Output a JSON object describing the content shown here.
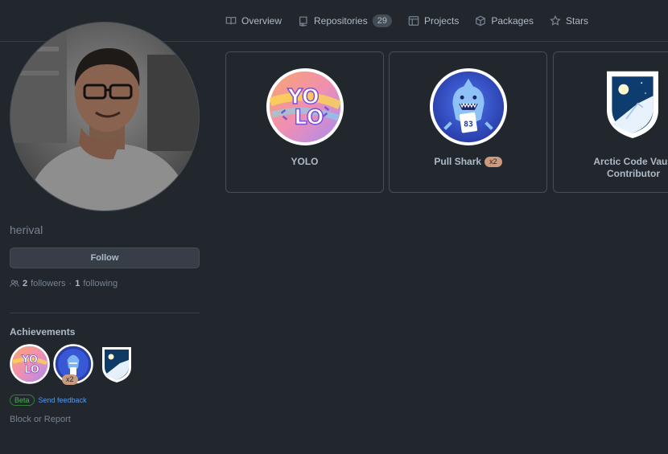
{
  "nav": {
    "items": [
      {
        "label": "Overview",
        "icon": "book-icon"
      },
      {
        "label": "Repositories",
        "icon": "repo-icon",
        "count": "29"
      },
      {
        "label": "Projects",
        "icon": "project-table-icon"
      },
      {
        "label": "Packages",
        "icon": "package-icon"
      },
      {
        "label": "Stars",
        "icon": "star-icon"
      }
    ]
  },
  "profile": {
    "username": "herival",
    "follow_label": "Follow",
    "followers_count": "2",
    "followers_label": "followers",
    "separator": "·",
    "following_count": "1",
    "following_label": "following"
  },
  "achievements": {
    "title": "Achievements",
    "mini_count": "x2",
    "beta_label": "Beta",
    "feedback_label": "Send feedback",
    "block_label": "Block or Report"
  },
  "cards": [
    {
      "title": "YOLO",
      "badge": "yolo-badge"
    },
    {
      "title": "Pull Shark",
      "tag": "x2",
      "badge": "pull-shark-badge"
    },
    {
      "title_line1": "Arctic Code Vault",
      "title_line2": "Contributor",
      "badge": "arctic-code-vault-badge"
    }
  ],
  "colors": {
    "background": "#22272e",
    "border": "#444c56",
    "text": "#adbac7",
    "muted": "#768390",
    "link": "#539bf5",
    "beta_green": "#57ab5a",
    "count_tag": "#c99a7c"
  }
}
